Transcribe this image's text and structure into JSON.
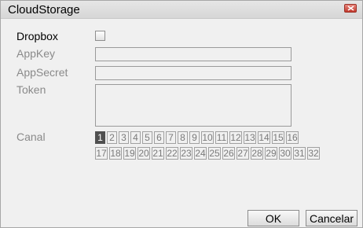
{
  "window": {
    "title": "CloudStorage"
  },
  "form": {
    "dropbox_label": "Dropbox",
    "dropbox_checked": false,
    "appkey_label": "AppKey",
    "appkey_value": "",
    "appsecret_label": "AppSecret",
    "appsecret_value": "",
    "token_label": "Token",
    "token_value": "",
    "canal_label": "Canal",
    "selected_channel": "1",
    "channels_row1": [
      "1",
      "2",
      "3",
      "4",
      "5",
      "6",
      "7",
      "8",
      "9",
      "10",
      "11",
      "12",
      "13",
      "14",
      "15",
      "16"
    ],
    "channels_row2": [
      "17",
      "18",
      "19",
      "20",
      "21",
      "22",
      "23",
      "24",
      "25",
      "26",
      "27",
      "28",
      "29",
      "30",
      "31",
      "32"
    ]
  },
  "buttons": {
    "ok": "OK",
    "cancel": "Cancelar"
  },
  "colors": {
    "selected_channel_bg": "#505050",
    "close_button": "#c2382c"
  }
}
